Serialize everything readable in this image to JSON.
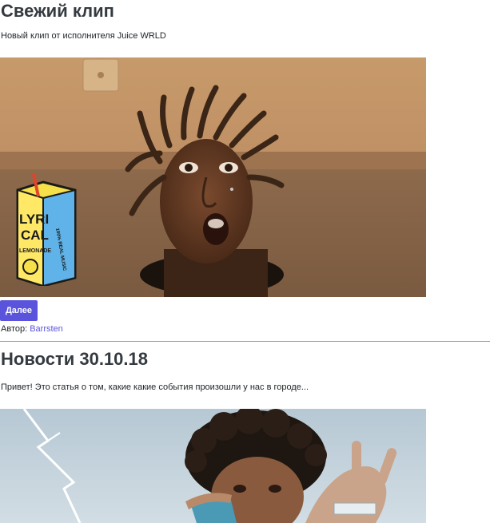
{
  "posts": [
    {
      "title": "Свежий клип",
      "description": "Новый клип от исполнителя Juice WRLD",
      "image_alt": "Juice WRLD",
      "more_label": "Далее",
      "author_label": "Автор:",
      "author_name": "Barrsten",
      "logo_text": {
        "line1": "LYRI",
        "line2": "CAL",
        "line3": "LEMONADE",
        "side": "100% REAL MUSIC"
      }
    },
    {
      "title": "Новости 30.10.18",
      "description": "Привет! Это статья о том, какие какие события произошли у нас в городе..."
    }
  ],
  "colors": {
    "accent": "#5a54dc",
    "title": "#343a40",
    "divider": "#9a9a9a"
  }
}
